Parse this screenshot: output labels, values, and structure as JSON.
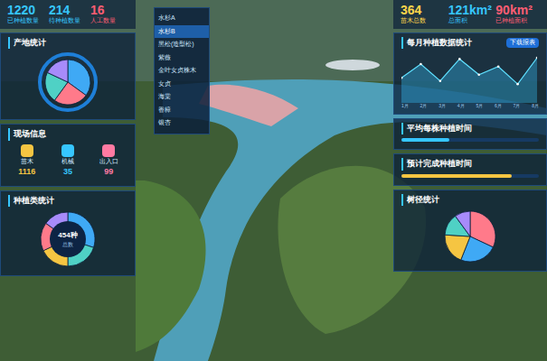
{
  "left_stats": [
    {
      "value": "1220",
      "label": "已种植数量",
      "color": "#36c6ff"
    },
    {
      "value": "214",
      "label": "待种植数量",
      "color": "#36c6ff"
    },
    {
      "value": "16",
      "label": "人工数量",
      "color": "#ff5d73"
    }
  ],
  "origin_chart": {
    "title": "产地统计",
    "values": [
      35,
      25,
      22,
      18
    ],
    "colors": [
      "#3fa9f5",
      "#ff7a8a",
      "#4fd1c5",
      "#a78bfa"
    ]
  },
  "site_info": {
    "title": "现场信息",
    "items": [
      {
        "label": "苗木",
        "value": "1116",
        "color": "#f5c542"
      },
      {
        "label": "机械",
        "value": "35",
        "color": "#36c6ff"
      },
      {
        "label": "出入口",
        "value": "99",
        "color": "#ff7aa2"
      }
    ]
  },
  "species_chart": {
    "title": "种植类统计",
    "center": "454种",
    "sub": "总数",
    "values": [
      30,
      20,
      18,
      17,
      15
    ],
    "colors": [
      "#3fa9f5",
      "#4fd1c5",
      "#f5c542",
      "#ff7a8a",
      "#a78bfa"
    ]
  },
  "dropdown": {
    "items": [
      {
        "label": "水杉A",
        "selected": false
      },
      {
        "label": "水杉B",
        "selected": true
      },
      {
        "label": "黑松(造型松)",
        "selected": false
      },
      {
        "label": "紫薇",
        "selected": false
      },
      {
        "label": "金叶女贞株木",
        "selected": false
      },
      {
        "label": "女贞",
        "selected": false
      },
      {
        "label": "海棠",
        "selected": false
      },
      {
        "label": "香樟",
        "selected": false
      },
      {
        "label": "银杏",
        "selected": false
      }
    ]
  },
  "right_stats": [
    {
      "value": "364",
      "label": "苗木总数",
      "color": "#ffd54a"
    },
    {
      "value": "121km²",
      "label": "总面积",
      "color": "#36c6ff"
    },
    {
      "value": "90km²",
      "label": "已种植面积",
      "color": "#ff5d73"
    }
  ],
  "monthly_chart": {
    "title": "每月种植数据统计",
    "button": "下载报表",
    "values": [
      40,
      62,
      35,
      70,
      45,
      58,
      30,
      72
    ],
    "ticks": [
      "1月",
      "2月",
      "3月",
      "4月",
      "5月",
      "6月",
      "7月",
      "8月"
    ]
  },
  "avg_time": {
    "title": "平均每株种植时间",
    "level": 0.35
  },
  "expected_time": {
    "title": "预计完成种植时间",
    "level": 0.8
  },
  "diameter_chart": {
    "title": "树径统计",
    "values": [
      32,
      24,
      20,
      14,
      10
    ],
    "colors": [
      "#ff7a8a",
      "#3fa9f5",
      "#f5c542",
      "#4fd1c5",
      "#a78bfa"
    ]
  }
}
